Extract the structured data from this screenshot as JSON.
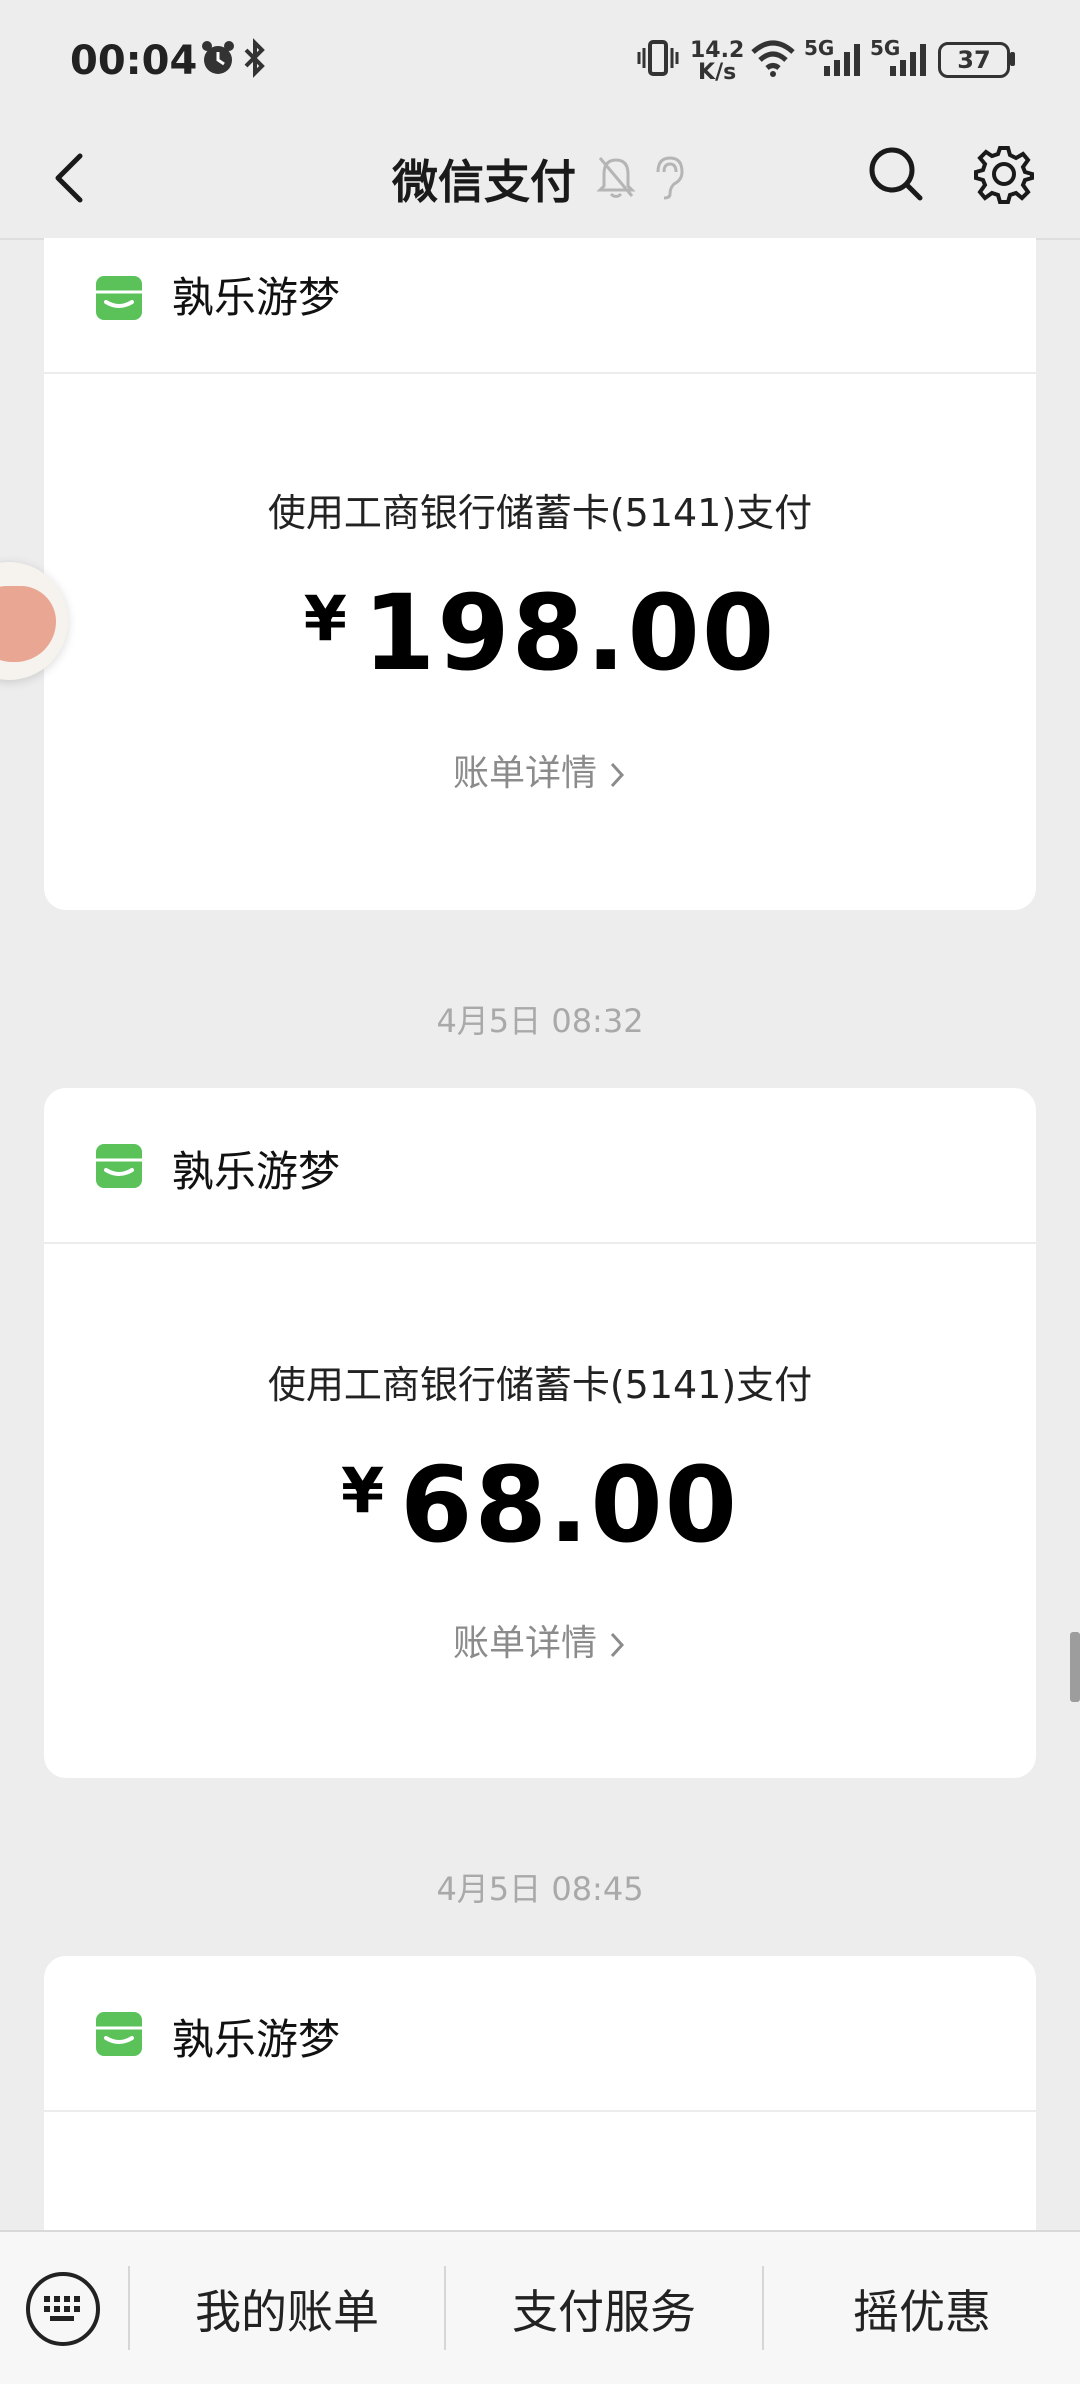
{
  "status_bar": {
    "time": "00:04",
    "net_speed_value": "14.2",
    "net_speed_unit": "K/s",
    "network_1": "5G",
    "network_2": "5G",
    "battery": "37"
  },
  "nav": {
    "title": "微信支付"
  },
  "cards": [
    {
      "merchant": "孰乐游梦",
      "pay_method": "使用工商银行储蓄卡(5141)支付",
      "currency": "¥",
      "amount": "198.00",
      "detail_label": "账单详情"
    },
    {
      "merchant": "孰乐游梦",
      "pay_method": "使用工商银行储蓄卡(5141)支付",
      "currency": "¥",
      "amount": "68.00",
      "detail_label": "账单详情"
    },
    {
      "merchant": "孰乐游梦"
    }
  ],
  "timestamps": [
    "4月5日 08:32",
    "4月5日 08:45"
  ],
  "bottom_bar": {
    "items": [
      "我的账单",
      "支付服务",
      "摇优惠"
    ]
  },
  "colors": {
    "brand_green": "#5bc25a",
    "background": "#ededed",
    "card": "#ffffff",
    "muted_text": "#8b8b8b"
  }
}
